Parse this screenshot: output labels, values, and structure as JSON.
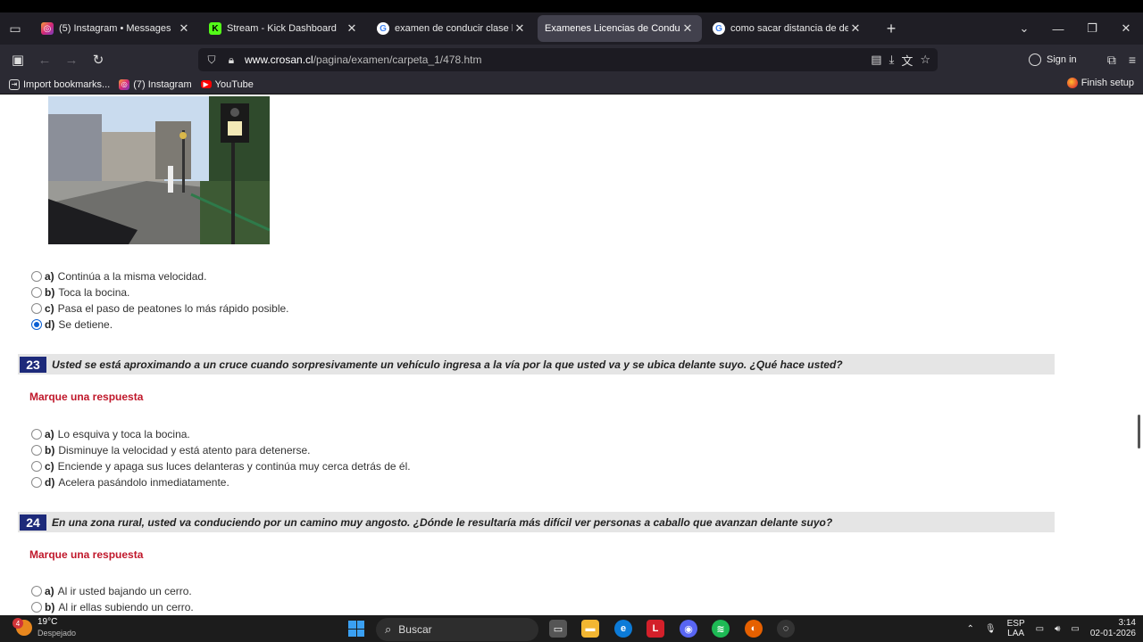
{
  "browser": {
    "tabs": [
      {
        "title": "(5) Instagram • Messages",
        "icon": "instagram-icon",
        "active": false
      },
      {
        "title": "Stream - Kick Dashboard",
        "icon": "kick-icon",
        "active": false
      },
      {
        "title": "examen de conducir clase b - B",
        "icon": "google-icon",
        "active": false
      },
      {
        "title": "Examenes Licencias de Conducir",
        "icon": "",
        "active": true
      },
      {
        "title": "como sacar distancia de detenc",
        "icon": "google-icon",
        "active": false
      }
    ],
    "url_host": "www.crosan.cl",
    "url_path": "/pagina/examen/carpeta_1/478.htm",
    "sign_in": "Sign in",
    "bookmarks": [
      {
        "label": "Import bookmarks..."
      },
      {
        "label": "(7) Instagram"
      },
      {
        "label": "YouTube"
      }
    ],
    "finish_setup": "Finish setup"
  },
  "questions": {
    "q22": {
      "options": [
        {
          "letter": "a)",
          "text": "Continúa a la misma velocidad.",
          "checked": false
        },
        {
          "letter": "b)",
          "text": "Toca la bocina.",
          "checked": false
        },
        {
          "letter": "c)",
          "text": "Pasa el paso de peatones lo más rápido posible.",
          "checked": false
        },
        {
          "letter": "d)",
          "text": "Se detiene.",
          "checked": true
        }
      ]
    },
    "q23": {
      "number": "23",
      "text": "Usted se está aproximando a un cruce cuando sorpresivamente un vehículo ingresa a la vía por la que usted va y se ubica delante suyo. ¿Qué hace usted?",
      "prompt": "Marque una respuesta",
      "options": [
        {
          "letter": "a)",
          "text": "Lo esquiva y toca la bocina.",
          "checked": false
        },
        {
          "letter": "b)",
          "text": "Disminuye la velocidad y está atento para detenerse.",
          "checked": false
        },
        {
          "letter": "c)",
          "text": "Enciende y apaga sus luces delanteras y continúa muy cerca detrás de él.",
          "checked": false
        },
        {
          "letter": "d)",
          "text": "Acelera pasándolo inmediatamente.",
          "checked": false
        }
      ]
    },
    "q24": {
      "number": "24",
      "text": "En una zona rural, usted va conduciendo por un camino muy angosto. ¿Dónde le resultaría más difícil ver personas a caballo que avanzan delante suyo?",
      "prompt": "Marque una respuesta",
      "options": [
        {
          "letter": "a)",
          "text": "Al ir usted bajando un cerro.",
          "checked": false
        },
        {
          "letter": "b)",
          "text": "Al ir ellas subiendo un cerro.",
          "checked": false
        }
      ]
    }
  },
  "taskbar": {
    "weather_temp": "19°C",
    "weather_desc": "Despejado",
    "weather_badge": "4",
    "search_label": "Buscar",
    "lang_top": "ESP",
    "lang_bottom": "LAA",
    "time": "3:14",
    "date": "02-01-2026"
  }
}
